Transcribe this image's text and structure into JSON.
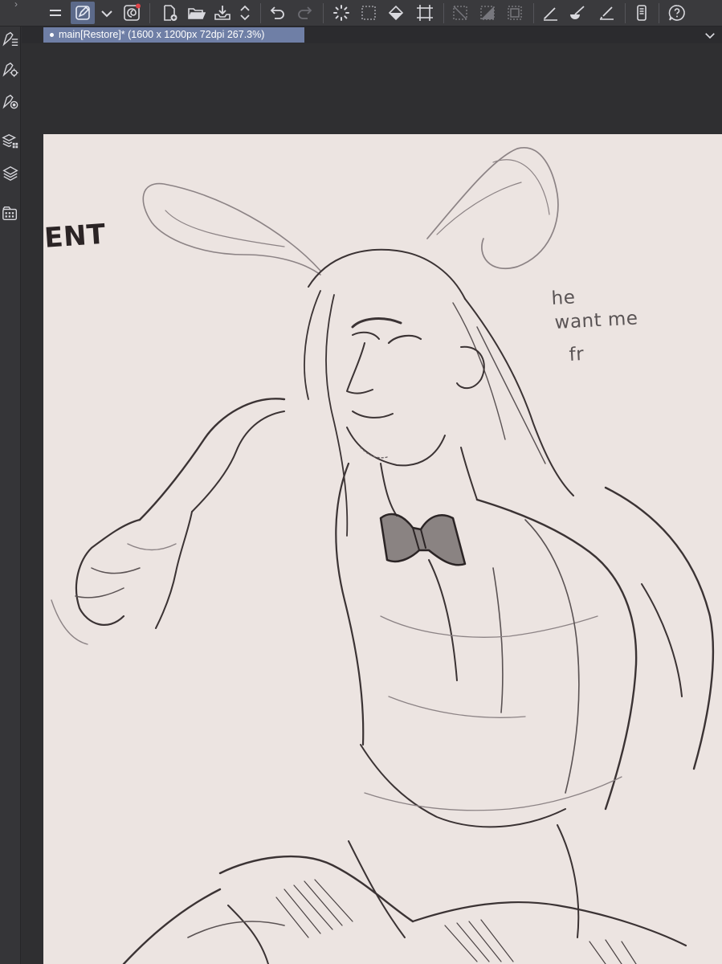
{
  "app": {
    "colors": {
      "toolbar_bg": "#3a3a3d",
      "tab_active": "#6f7fa6",
      "canvas_bg": "#2f2f31",
      "paper": "#ece4e1",
      "ink": "#3b3334",
      "pencil": "#8c8385"
    }
  },
  "command_bar": {
    "icons": [
      "menu-icon",
      "edit-pen-icon",
      "chevron-down-icon",
      "restore-icon",
      "new-document-icon",
      "open-folder-icon",
      "save-icon",
      "up-down-arrows-icon",
      "undo-icon",
      "redo-icon",
      "loading-spinner-icon",
      "selection-marquee-icon",
      "fill-bucket-icon",
      "transform-icon",
      "deselect-icon",
      "invert-selection-icon",
      "selection-border-icon",
      "pen-brush-icon",
      "blend-tool-icon",
      "ruler-icon",
      "smartphone-icon",
      "help-icon"
    ]
  },
  "left_tools": [
    "brush-settings-icon",
    "tool-property-icon",
    "sub-tool-detail-icon",
    "layer-property-icon",
    "layers-icon",
    "material-icon"
  ],
  "document": {
    "tab_title": "main[Restore]* (1600 x 1200px 72dpi 267.3%)"
  },
  "sketch": {
    "note_lines": [
      "he",
      "want me",
      "fr"
    ],
    "partial_heading": "ENT"
  }
}
